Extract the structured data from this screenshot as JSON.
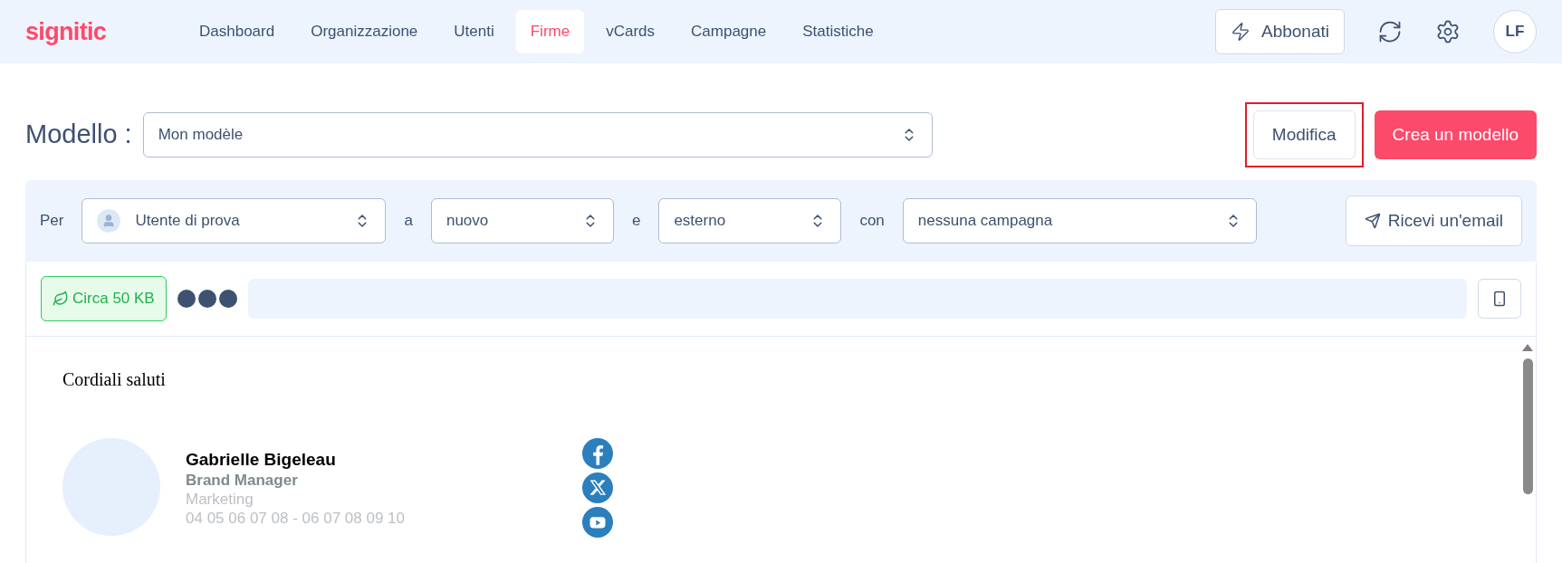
{
  "logo": "signitic",
  "nav": [
    {
      "label": "Dashboard",
      "selected": false
    },
    {
      "label": "Organizzazione",
      "selected": false
    },
    {
      "label": "Utenti",
      "selected": false
    },
    {
      "label": "Firme",
      "selected": true
    },
    {
      "label": "vCards",
      "selected": false
    },
    {
      "label": "Campagne",
      "selected": false
    },
    {
      "label": "Statistiche",
      "selected": false
    }
  ],
  "subscribe_button": "Abbonati",
  "avatar": "LF",
  "model": {
    "label": "Modello :",
    "value": "Mon modèle"
  },
  "edit_button": {
    "label": "Modifica",
    "highlighted": true
  },
  "create_button": "Crea un modello",
  "filters": [
    {
      "prefix": "Per",
      "value": "Utente di prova",
      "kind": "user"
    },
    {
      "prefix": "a",
      "value": "nuovo",
      "kind": "plain"
    },
    {
      "prefix": "e",
      "value": "esterno",
      "kind": "plain"
    },
    {
      "prefix": "con",
      "value": "nessuna campagna",
      "kind": "wide"
    }
  ],
  "email_button": "Ricevi un'email",
  "size_badge": "Circa 50 KB",
  "preview": {
    "greeting": "Cordiali saluti",
    "name": "Gabrielle Bigeleau",
    "title": "Brand Manager",
    "department": "Marketing",
    "phones": "04 05 06 07 08 - 06 07 08 09 10",
    "socials": [
      {
        "kind": "facebook"
      },
      {
        "kind": "x"
      },
      {
        "kind": "youtube"
      }
    ]
  }
}
